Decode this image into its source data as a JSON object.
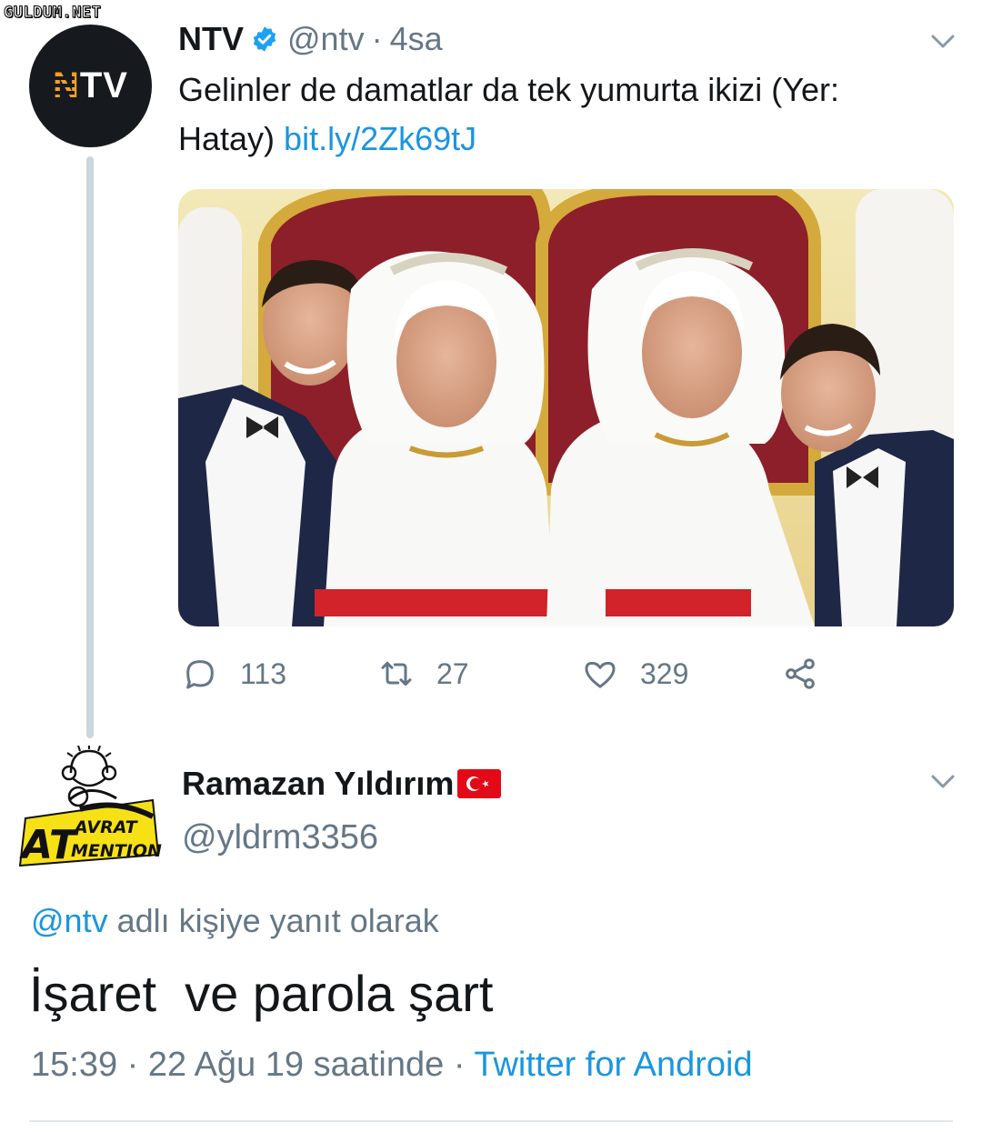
{
  "watermark": "GULDUM.NET",
  "tweet": {
    "author_name": "NTV",
    "author_handle": "@ntv",
    "time_sep": "·",
    "time": "4sa",
    "avatar_logo": "NTV",
    "text": "Gelinler de damatlar da tek yumurta ikizi (Yer: Hatay)",
    "link": "bit.ly/2Zk69tJ",
    "photo_icon": "wedding-photo",
    "actions": {
      "replies": "113",
      "retweets": "27",
      "likes": "329"
    },
    "colors": {
      "verified": "#1da1f2",
      "link": "#1b95e0",
      "muted": "#657786"
    }
  },
  "reply": {
    "author_name": "Ramazan Yıldırım",
    "flag_icon": "turkey-flag",
    "author_handle": "@yldrm3356",
    "avatar_text_main": "AT",
    "avatar_text_top": "AVRAT",
    "avatar_text_bottom": "MENTION",
    "replying_to_mention": "@ntv",
    "replying_to_suffix": " adlı kişiye yanıt olarak",
    "text": "İşaret  ve parola şart",
    "timestamp": "15:39 · 22 Ağu 19 saatinde · ",
    "source": "Twitter for Android"
  }
}
